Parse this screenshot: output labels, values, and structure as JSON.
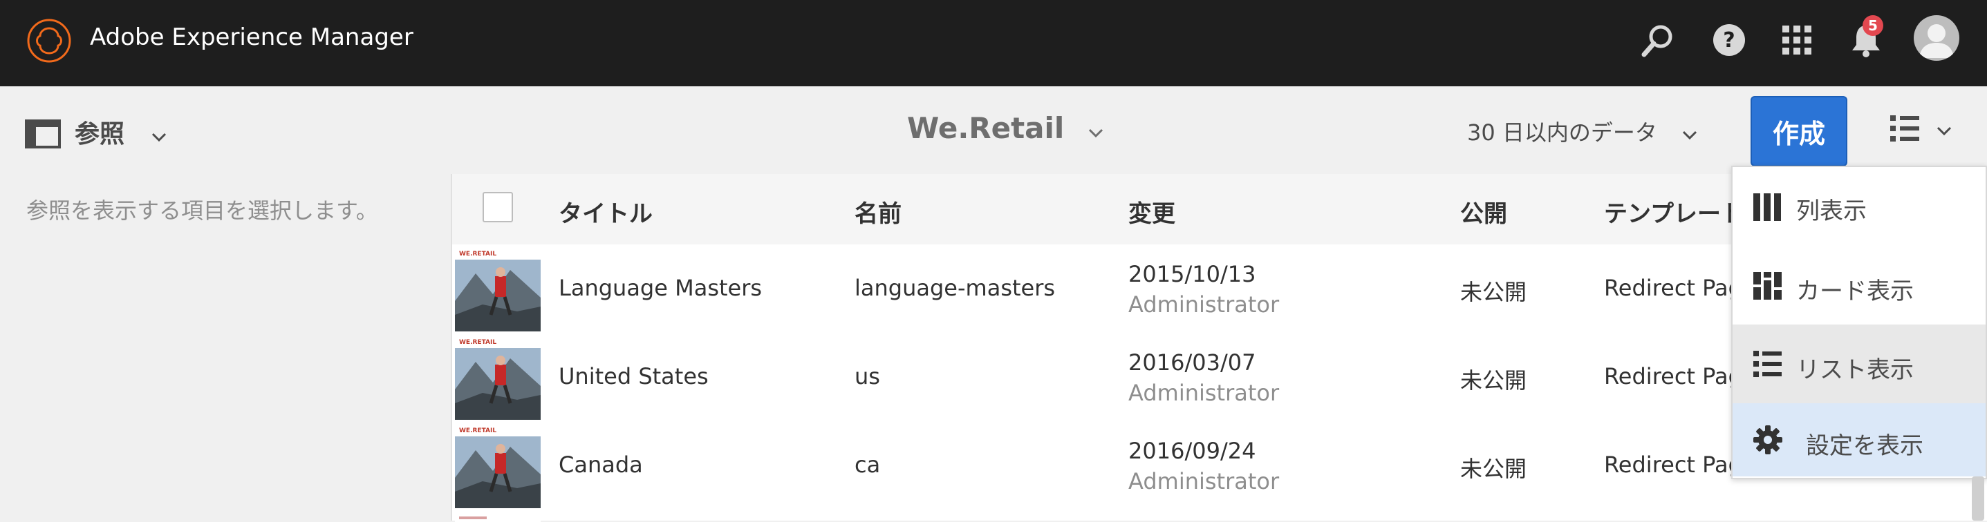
{
  "app": {
    "title": "Adobe Experience Manager",
    "notification_count": "5"
  },
  "actionbar": {
    "rail_label": "参照",
    "breadcrumb_title": "We.Retail",
    "filter_label": "30 日以内のデータ",
    "create_label": "作成"
  },
  "rail": {
    "empty_message": "参照を表示する項目を選択します。"
  },
  "table": {
    "headers": [
      "タイトル",
      "名前",
      "変更",
      "公開",
      "テンプレート"
    ],
    "rows": [
      {
        "title": "Language Masters",
        "name": "language-masters",
        "modified_date": "2015/10/13",
        "modified_by": "Administrator",
        "published": "未公開",
        "template": "Redirect Page",
        "thumb_brand": "WE.RETAIL"
      },
      {
        "title": "United States",
        "name": "us",
        "modified_date": "2016/03/07",
        "modified_by": "Administrator",
        "published": "未公開",
        "template": "Redirect Page",
        "thumb_brand": "WE.RETAIL"
      },
      {
        "title": "Canada",
        "name": "ca",
        "modified_date": "2016/09/24",
        "modified_by": "Administrator",
        "published": "未公開",
        "template": "Redirect Page",
        "thumb_brand": "WE.RETAIL"
      }
    ]
  },
  "view_menu": {
    "items": [
      {
        "label": "列表示",
        "icon": "column-view-icon"
      },
      {
        "label": "カード表示",
        "icon": "card-view-icon"
      },
      {
        "label": "リスト表示",
        "icon": "list-view-icon",
        "selected": true
      },
      {
        "label": "設定を表示",
        "icon": "gear-icon"
      }
    ]
  },
  "colors": {
    "topbar": "#1e1e1e",
    "accent": "#2b74d6",
    "logo": "#f26a1b",
    "badge": "#e34850"
  }
}
